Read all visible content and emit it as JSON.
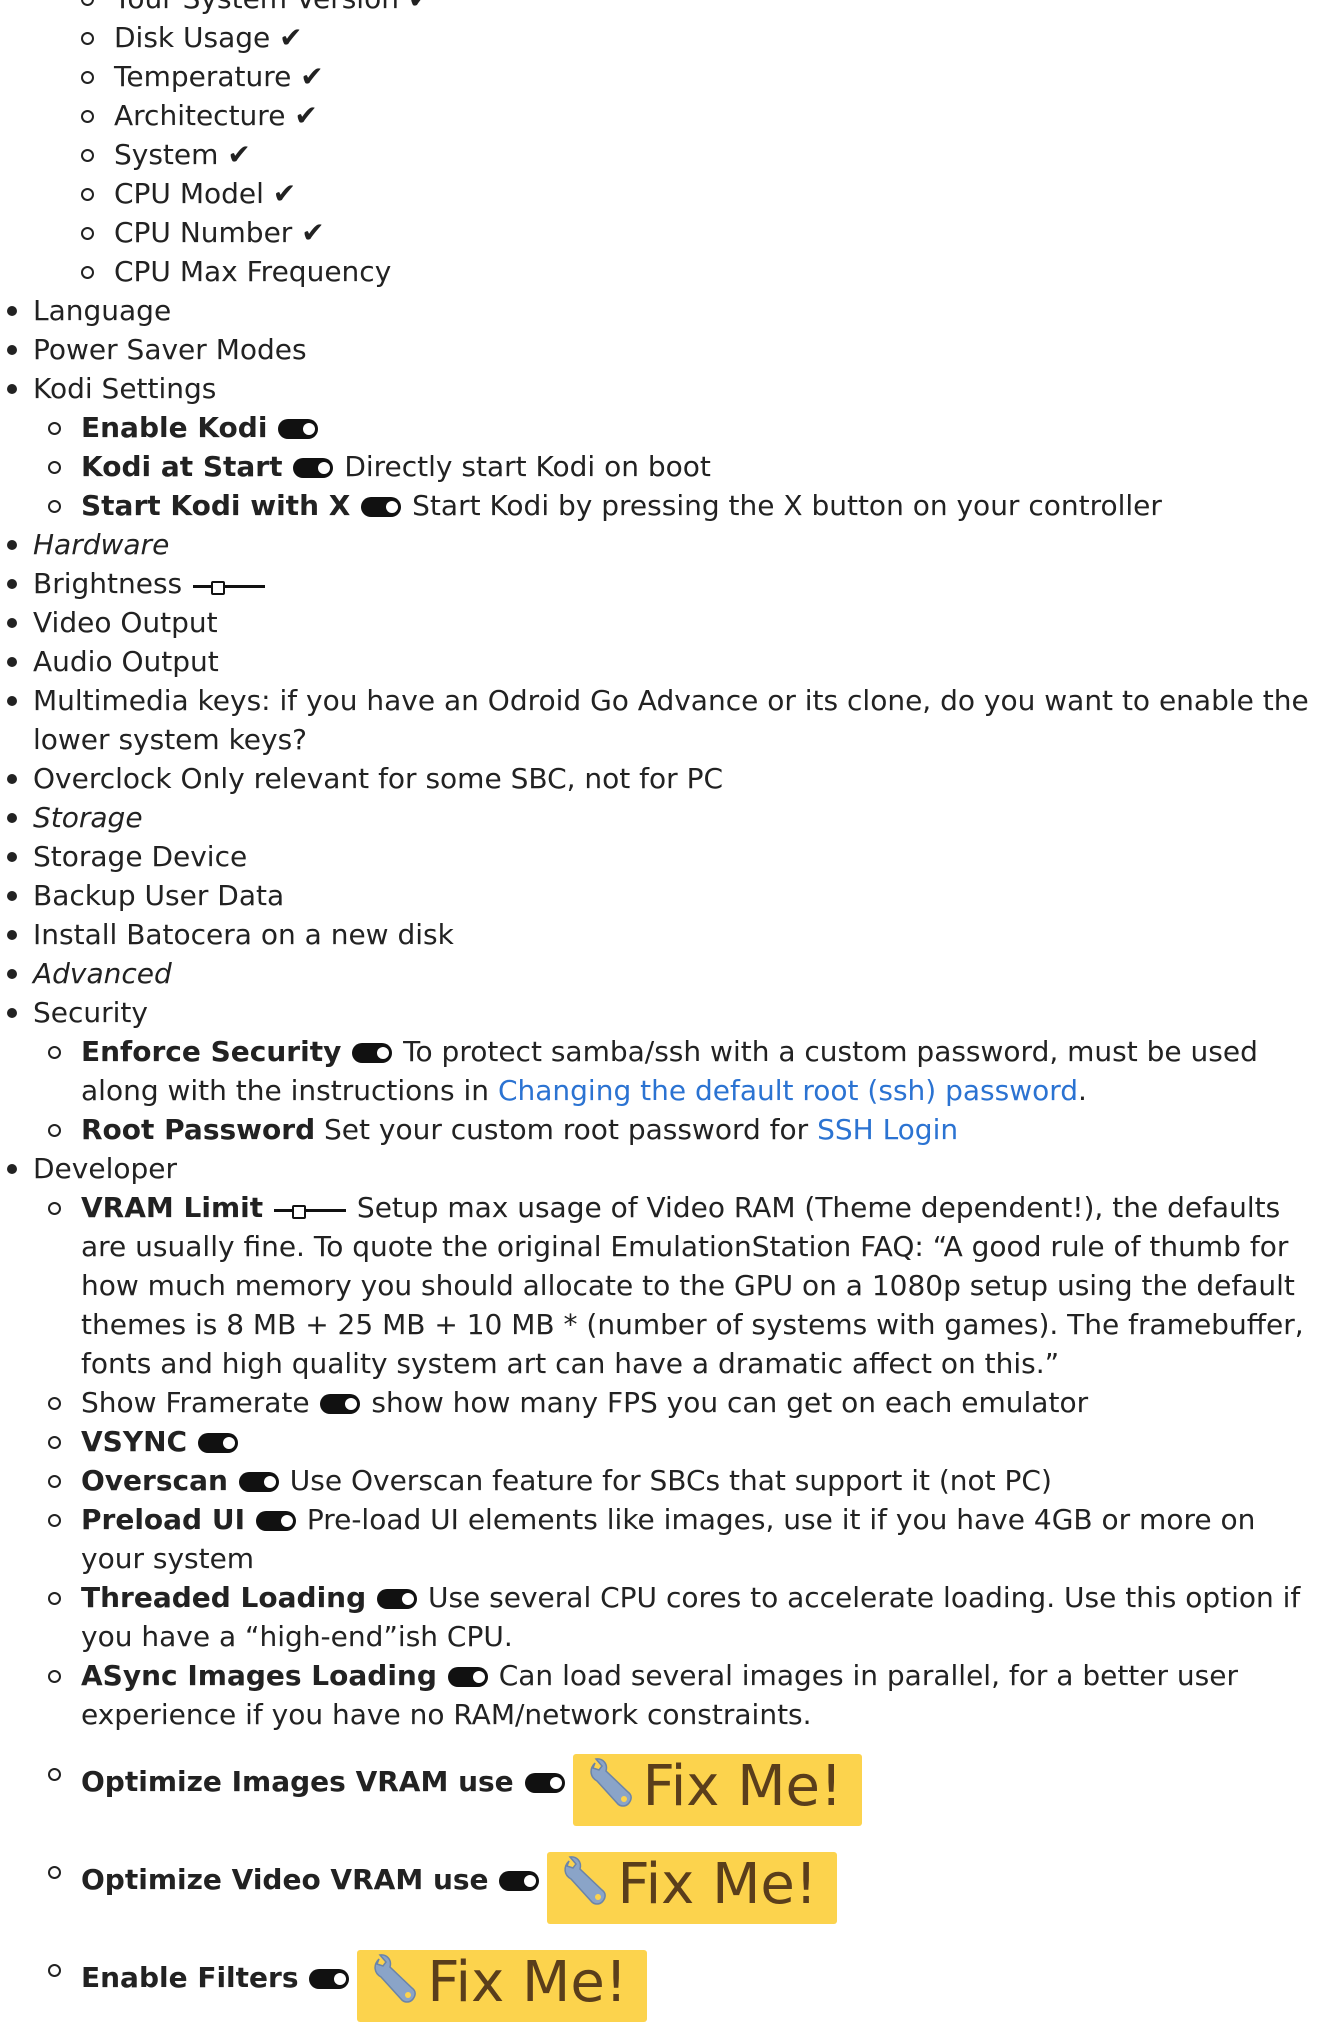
{
  "top_items": [
    "Your System Version ✔",
    "Disk Usage ✔",
    "Temperature ✔",
    "Architecture ✔",
    "System ✔",
    "CPU Model ✔",
    "CPU Number ✔",
    "CPU Max Frequency"
  ],
  "items": {
    "language": "Language",
    "power_saver": "Power Saver Modes",
    "kodi_settings": "Kodi Settings",
    "enable_kodi": "Enable Kodi",
    "kodi_at_start": "Kodi at Start",
    "kodi_at_start_desc": "Directly start Kodi on boot",
    "start_kodi_x": "Start Kodi with X",
    "start_kodi_x_desc": "Start Kodi by pressing the X button on your controller",
    "hardware": "Hardware",
    "brightness": "Brightness",
    "video_output": "Video Output",
    "audio_output": "Audio Output",
    "multimedia_keys": "Multimedia keys: if you have an Odroid Go Advance or its clone, do you want to enable the lower system keys?",
    "overclock": "Overclock Only relevant for some SBC, not for PC",
    "storage": "Storage",
    "storage_device": "Storage Device",
    "backup_user_data": "Backup User Data",
    "install_batocera": "Install Batocera on a new disk",
    "advanced": "Advanced",
    "security": "Security",
    "enforce_security": "Enforce Security",
    "enforce_security_desc": "To protect samba/ssh with a custom password, must be used along with the instructions in",
    "enforce_security_link": "Changing the default root (ssh) password",
    "root_password": "Root Password",
    "root_password_desc": "Set your custom root password for",
    "root_password_link": "SSH Login",
    "developer": "Developer",
    "vram_limit": "VRAM Limit",
    "vram_limit_desc": "Setup max usage of Video RAM (Theme dependent!), the defaults are usually fine. To quote the original EmulationStation FAQ: “A good rule of thumb for how much memory you should allocate to the GPU on a 1080p setup using the default themes is 8 MB + 25 MB + 10 MB * (number of systems with games). The framebuffer, fonts and high quality system art can have a dramatic affect on this.”",
    "show_framerate": "Show Framerate",
    "show_framerate_desc": "show how many FPS you can get on each emulator",
    "vsync": "VSYNC",
    "overscan": "Overscan",
    "overscan_desc": "Use Overscan feature for SBCs that support it (not PC)",
    "preload_ui": "Preload UI",
    "preload_ui_desc": "Pre-load UI elements like images, use it if you have 4GB or more on your system",
    "threaded_loading": "Threaded Loading",
    "threaded_loading_desc": "Use several CPU cores to accelerate loading. Use this option if you have a “high-end”ish CPU.",
    "async_images": "ASync Images Loading",
    "async_images_desc": "Can load several images in parallel, for a better user experience if you have no RAM/network constraints.",
    "optimize_images": "Optimize Images VRAM use",
    "optimize_video": "Optimize Video VRAM use",
    "enable_filters": "Enable Filters",
    "fixme": "Fix Me!"
  },
  "colors": {
    "link": "#2b73d2",
    "fixme_bg": "#fcd34d",
    "fixme_text": "#5a3e1b"
  }
}
